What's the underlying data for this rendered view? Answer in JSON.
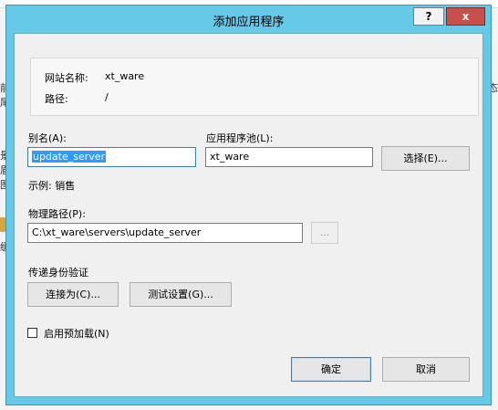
{
  "background": {
    "left_fragments": [
      "前",
      "尾",
      "景",
      "眉",
      "图",
      "缓"
    ],
    "right_fragment": "态"
  },
  "dialog": {
    "title": "添加应用程序",
    "help_label": "?",
    "close_label": "x",
    "site_name_label": "网站名称:",
    "site_name_value": "xt_ware",
    "path_label": "路径:",
    "path_value": "/",
    "alias_label": "别名(A):",
    "alias_value": "update_server",
    "app_pool_label": "应用程序池(L):",
    "app_pool_value": "xt_ware",
    "select_button": "选择(E)...",
    "example_text": "示例: 销售",
    "physical_path_label": "物理路径(P):",
    "physical_path_value": "C:\\xt_ware\\servers\\update_server",
    "browse_button": "...",
    "pass_through_label": "传递身份验证",
    "connect_as_button": "连接为(C)...",
    "test_settings_button": "测试设置(G)...",
    "preload_label": "启用预加载(N)",
    "ok_button": "确定",
    "cancel_button": "取消"
  },
  "colors": {
    "title_bar": "#67c9e8",
    "close_button": "#c7504b",
    "selection": "#3399ff"
  }
}
